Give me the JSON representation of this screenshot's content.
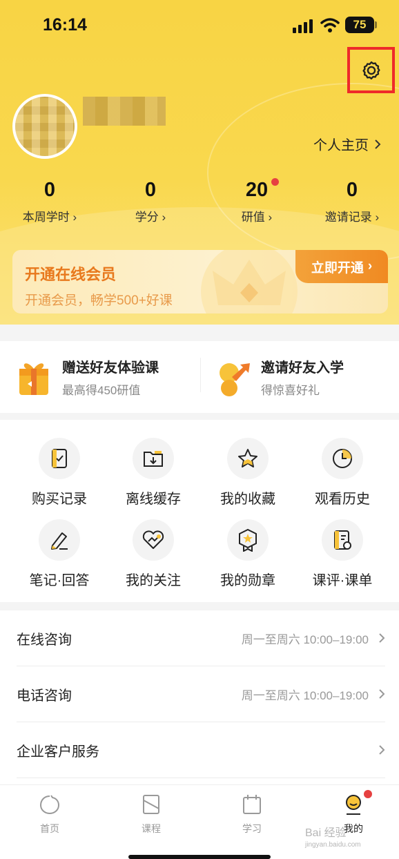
{
  "status_bar": {
    "time": "16:14",
    "battery": "75"
  },
  "profile": {
    "homepage_label": "个人主页"
  },
  "stats": [
    {
      "value": "0",
      "label": "本周学时"
    },
    {
      "value": "0",
      "label": "学分"
    },
    {
      "value": "20",
      "label": "研值"
    },
    {
      "value": "0",
      "label": "邀请记录"
    }
  ],
  "vip": {
    "title": "开通在线会员",
    "subtitle": "开通会员，畅学500+好课",
    "button": "立即开通"
  },
  "promos": [
    {
      "title": "赠送好友体验课",
      "subtitle": "最高得450研值"
    },
    {
      "title": "邀请好友入学",
      "subtitle": "得惊喜好礼"
    }
  ],
  "grid": [
    {
      "label": "购买记录",
      "icon": "purchase-record-icon"
    },
    {
      "label": "离线缓存",
      "icon": "offline-cache-icon"
    },
    {
      "label": "我的收藏",
      "icon": "star-icon"
    },
    {
      "label": "观看历史",
      "icon": "clock-icon"
    },
    {
      "label": "笔记·回答",
      "icon": "pen-icon"
    },
    {
      "label": "我的关注",
      "icon": "heart-icon"
    },
    {
      "label": "我的勋章",
      "icon": "medal-icon"
    },
    {
      "label": "课评·课单",
      "icon": "review-icon"
    }
  ],
  "list": [
    {
      "title": "在线咨询",
      "meta": "周一至周六 10:00–19:00"
    },
    {
      "title": "电话咨询",
      "meta": "周一至周六 10:00–19:00"
    },
    {
      "title": "企业客户服务",
      "meta": ""
    }
  ],
  "tabs": [
    {
      "label": "首页",
      "icon": "home-icon"
    },
    {
      "label": "课程",
      "icon": "course-icon"
    },
    {
      "label": "学习",
      "icon": "calendar-icon"
    },
    {
      "label": "我的",
      "icon": "profile-icon"
    }
  ],
  "watermark": {
    "text": "Bai 经验",
    "url": "jingyan.baidu.com"
  },
  "colors": {
    "header_yellow": "#f9d84e",
    "vip_orange": "#f08a22",
    "badge_red": "#e64141",
    "highlight_red": "#ee2a2a"
  }
}
